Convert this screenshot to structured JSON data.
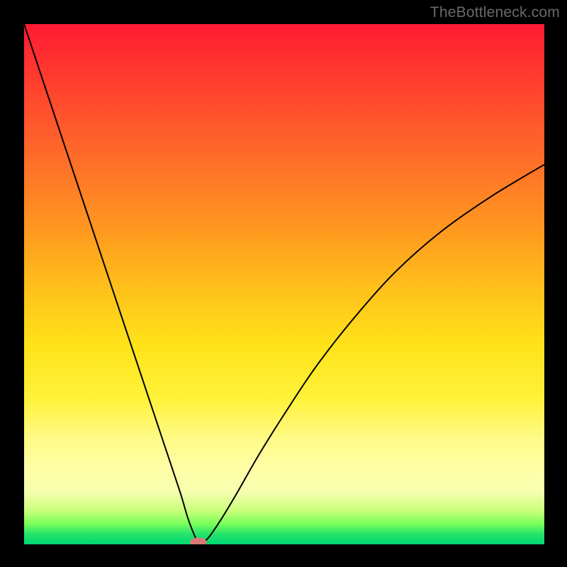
{
  "watermark": {
    "text": "TheBottleneck.com"
  },
  "colors": {
    "curve": "#000000",
    "marker": "#d97b74",
    "background_black": "#000000"
  },
  "chart_data": {
    "type": "line",
    "title": "",
    "xlabel": "",
    "ylabel": "",
    "xlim": [
      0,
      100
    ],
    "ylim": [
      0,
      100
    ],
    "grid": false,
    "legend": false,
    "annotations": [],
    "series": [
      {
        "name": "bottleneck-curve",
        "x": [
          0,
          3,
          6,
          9,
          12,
          15,
          18,
          21,
          24,
          27,
          30,
          31.5,
          33,
          34,
          35,
          36,
          38,
          41,
          45,
          50,
          56,
          63,
          71,
          80,
          90,
          100
        ],
        "y": [
          100,
          91,
          82,
          73,
          64,
          55,
          46,
          37,
          28,
          19,
          10,
          5,
          1.2,
          0,
          0.8,
          2,
          5,
          10,
          17,
          25,
          34,
          43,
          52,
          60,
          67,
          73
        ]
      }
    ],
    "marker": {
      "x": 33.5,
      "y": 0,
      "rx": 1.6,
      "ry": 0.9
    }
  }
}
